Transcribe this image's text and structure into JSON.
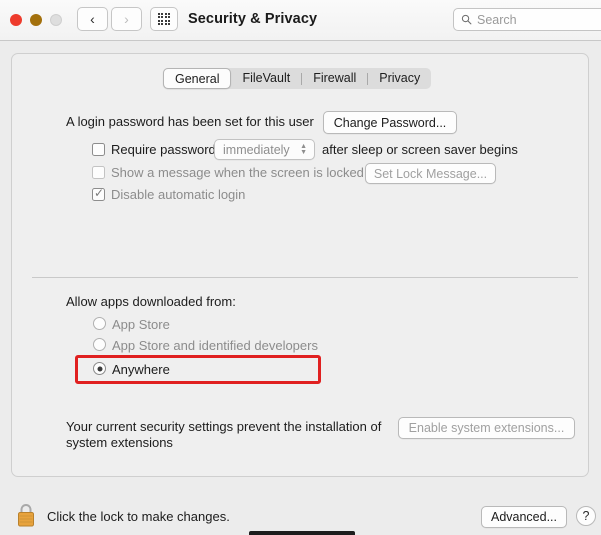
{
  "window": {
    "title": "Security & Privacy",
    "traffic_lights": [
      "close-button",
      "minimize-button",
      "zoom-button"
    ],
    "back_label": "‹",
    "forward_label": "›",
    "grid_icon": "grid-view-icon"
  },
  "search": {
    "placeholder": "Search",
    "value": "",
    "icon": "search-icon"
  },
  "tabs": [
    {
      "label": "General",
      "active": true
    },
    {
      "label": "FileVault",
      "active": false
    },
    {
      "label": "Firewall",
      "active": false
    },
    {
      "label": "Privacy",
      "active": false
    }
  ],
  "general": {
    "password_status": "A login password has been set for this user",
    "change_password_button": "Change Password...",
    "require_password": {
      "label_before": "Require password",
      "delay_value": "immediately",
      "label_after": "after sleep or screen saver begins",
      "checked": false
    },
    "show_message": {
      "label": "Show a message when the screen is locked",
      "button": "Set Lock Message...",
      "checked": false
    },
    "disable_auto_login": {
      "label": "Disable automatic login",
      "checked": true,
      "tick": "✓"
    }
  },
  "gatekeeper": {
    "heading": "Allow apps downloaded from:",
    "options": [
      {
        "label": "App Store",
        "selected": false
      },
      {
        "label": "App Store and identified developers",
        "selected": false
      },
      {
        "label": "Anywhere",
        "selected": true
      }
    ],
    "highlight_color": "#e02020",
    "highlighted_option": "Anywhere"
  },
  "system_extensions": {
    "message": "Your current security settings prevent the installation of\nsystem extensions",
    "button": "Enable system extensions...",
    "button_disabled": true
  },
  "footer": {
    "lock_icon": "lock-closed-icon",
    "lock_text": "Click the lock to make changes.",
    "advanced_button": "Advanced...",
    "help_button": "?"
  }
}
